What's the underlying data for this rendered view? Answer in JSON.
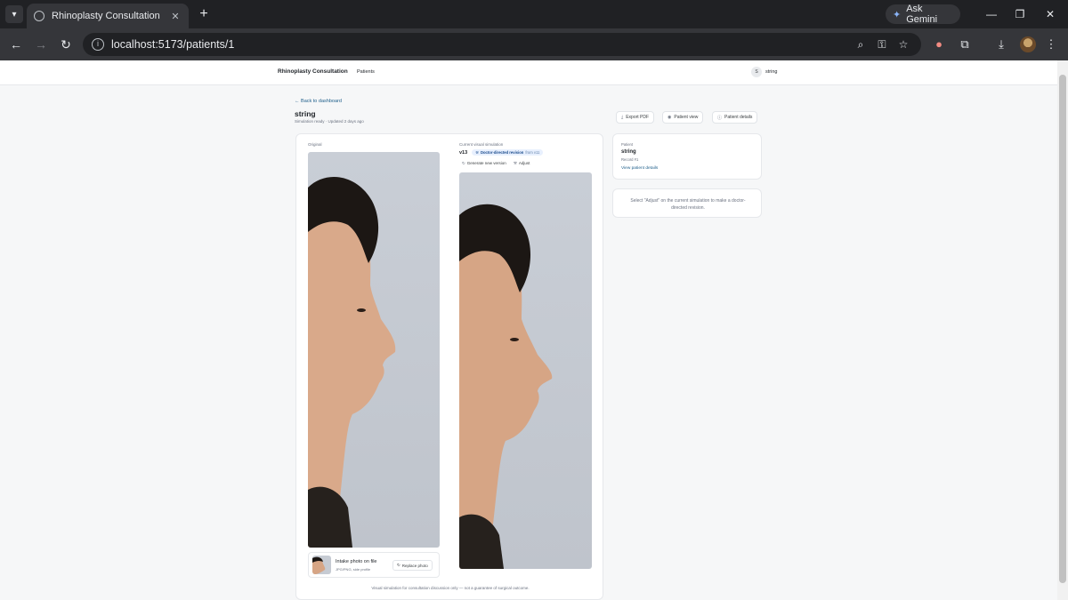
{
  "browser": {
    "tab_title": "Rhinoplasty Consultation",
    "url": "localhost:5173/patients/1",
    "gemini_label": "Ask Gemini"
  },
  "app": {
    "brand": "Rhinoplasty Consultation",
    "nav_patients": "Patients",
    "user_initial": "S",
    "user_name": "string"
  },
  "page": {
    "back_link": "← Back to dashboard",
    "title": "string",
    "subtitle": "Simulation ready · Updated 2 days ago",
    "actions": {
      "export_pdf": "Export PDF",
      "patient_view": "Patient view",
      "patient_details": "Patient details"
    }
  },
  "original": {
    "label": "Original"
  },
  "simulation": {
    "label": "Current visual simulation",
    "version": "v13",
    "badge_text": "Doctor-directed revision",
    "badge_from": "from v11",
    "generate_label": "Generate new version",
    "adjust_label": "Adjust"
  },
  "intake": {
    "title": "Intake photo on file",
    "subtitle": "JPG/PNG, side profile",
    "replace_label": "Replace photo"
  },
  "disclaimer": "Visual simulation for consultation discussion only — not a guarantee of surgical outcome.",
  "patient_card": {
    "label": "Patient",
    "name": "string",
    "record": "Record #1",
    "link": "View patient details"
  },
  "hint": "Select \"Adjust\" on the current simulation to make a doctor-directed revision.",
  "colors": {
    "accent_link": "#1f5f8b",
    "badge_bg": "#e8f0fe",
    "photo_bg": "#c9ced6"
  }
}
